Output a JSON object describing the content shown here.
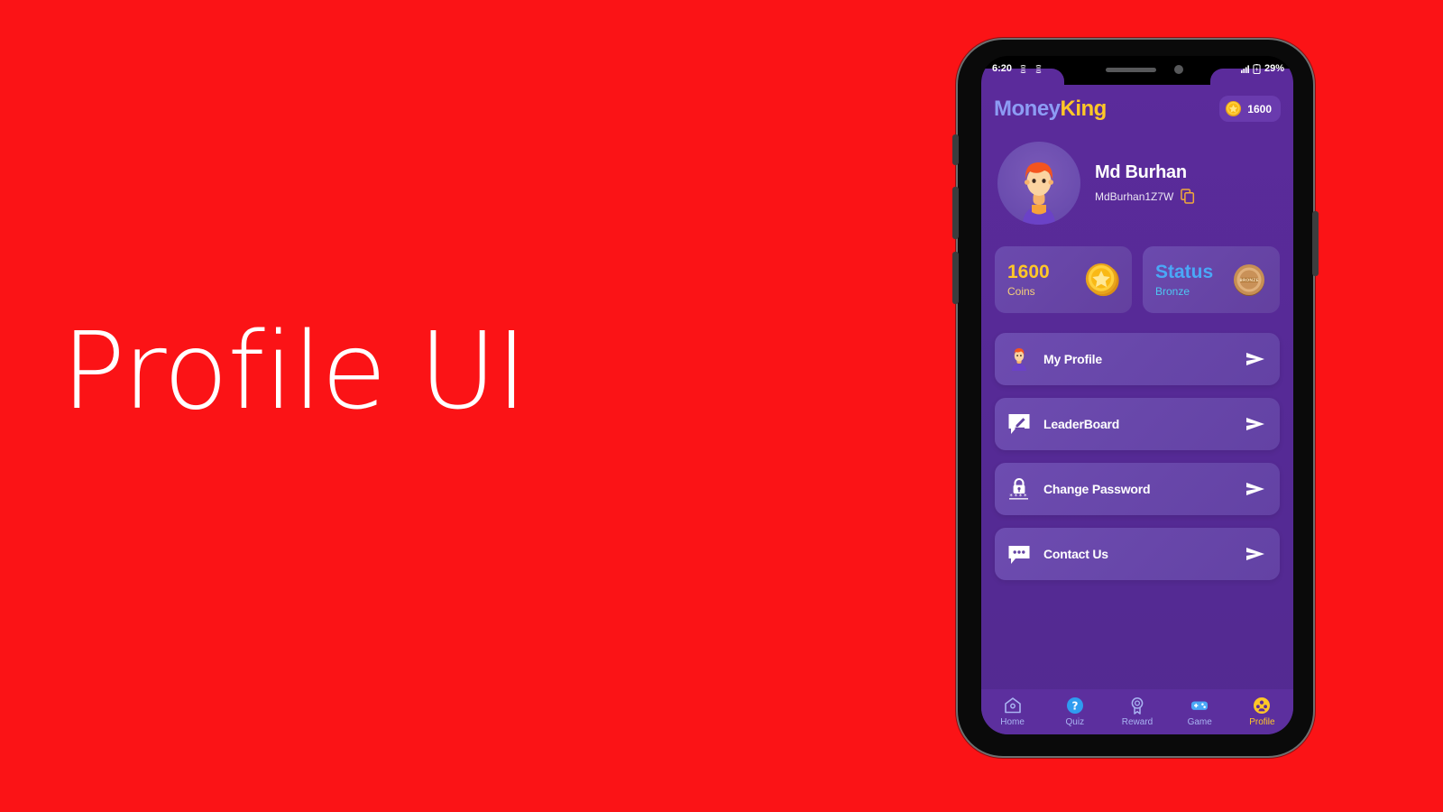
{
  "poster": {
    "headline": "Profile UI",
    "background_color": "#fb1316",
    "headline_color": "#ffffff"
  },
  "status_bar": {
    "time": "6:20",
    "battery_percent": "29%",
    "icons": [
      "sync-icon",
      "sync-icon",
      "signal-icon",
      "battery-icon"
    ]
  },
  "app": {
    "logo": {
      "part1": "Money",
      "part2": "King",
      "part1_color": "#8d9cf4",
      "part2_color": "#ffc727"
    },
    "coin_badge": {
      "amount": "1600",
      "icon": "coin-star-icon"
    },
    "profile": {
      "name": "Md Burhan",
      "user_id": "MdBurhan1Z7W",
      "copy_icon": "copy-icon",
      "avatar_icon": "avatar-icon"
    },
    "stats": [
      {
        "key": "coins",
        "value": "1600",
        "label": "Coins",
        "icon": "coin-star-icon",
        "value_color": "#ffc727",
        "label_color": "#f5cf7a"
      },
      {
        "key": "status",
        "value": "Status",
        "label": "Bronze",
        "icon": "bronze-medal-icon",
        "value_color": "#4aa8f7",
        "label_color": "#4ec7f2"
      }
    ],
    "menu": [
      {
        "label": "My Profile",
        "icon": "person-avatar-icon",
        "arrow": "send-arrow-icon"
      },
      {
        "label": "LeaderBoard",
        "icon": "edit-chat-icon",
        "arrow": "send-arrow-icon"
      },
      {
        "label": "Change Password",
        "icon": "lock-asterisks-icon",
        "arrow": "send-arrow-icon"
      },
      {
        "label": "Contact Us",
        "icon": "chat-dots-icon",
        "arrow": "send-arrow-icon"
      }
    ],
    "bottom_nav": {
      "active_index": 4,
      "active_color": "#ffc727",
      "inactive_color": "#a9b4f2",
      "items": [
        {
          "label": "Home",
          "icon": "home-icon"
        },
        {
          "label": "Quiz",
          "icon": "question-circle-icon"
        },
        {
          "label": "Reward",
          "icon": "award-ribbon-icon"
        },
        {
          "label": "Game",
          "icon": "gamepad-icon"
        },
        {
          "label": "Profile",
          "icon": "people-circle-icon"
        }
      ]
    }
  },
  "android_navigation": {
    "back": "back-triangle-icon",
    "home": "home-circle-icon",
    "recents": "recents-square-icon"
  }
}
